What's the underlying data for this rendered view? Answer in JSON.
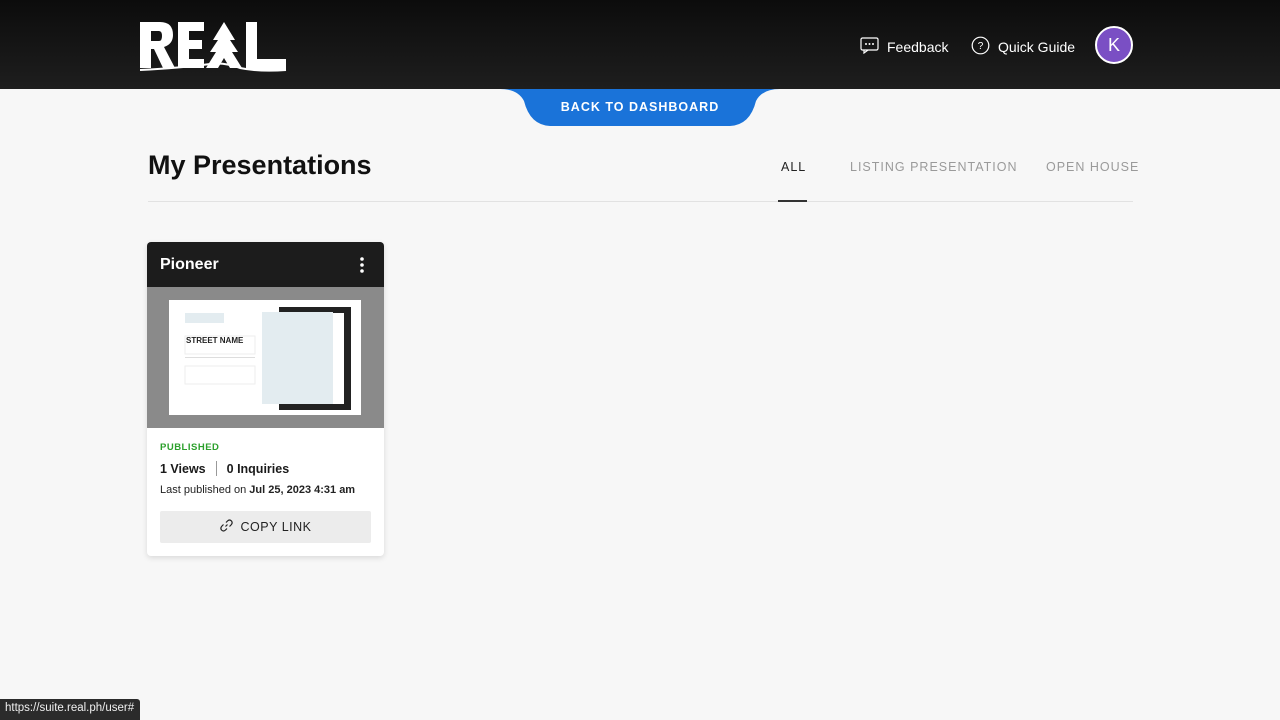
{
  "header": {
    "logo_text": "REAL",
    "feedback_label": "Feedback",
    "guide_label": "Quick Guide",
    "avatar_initial": "K",
    "avatar_color": "#7a4fc4"
  },
  "back_button": {
    "label": "BACK TO DASHBOARD",
    "color": "#1a73d9"
  },
  "page": {
    "title": "My Presentations",
    "tabs": [
      {
        "label": "ALL",
        "active": true
      },
      {
        "label": "LISTING PRESENTATION",
        "active": false
      },
      {
        "label": "OPEN HOUSE",
        "active": false
      }
    ]
  },
  "presentations": [
    {
      "title": "Pioneer",
      "thumbnail_heading": "STREET NAME",
      "status": "PUBLISHED",
      "views": "1 Views",
      "inquiries": "0 Inquiries",
      "published_prefix": "Last published on ",
      "published_date": "Jul 25, 2023 4:31 am",
      "copy_label": "COPY LINK"
    }
  ],
  "browser_status_url": "https://suite.real.ph/user#"
}
